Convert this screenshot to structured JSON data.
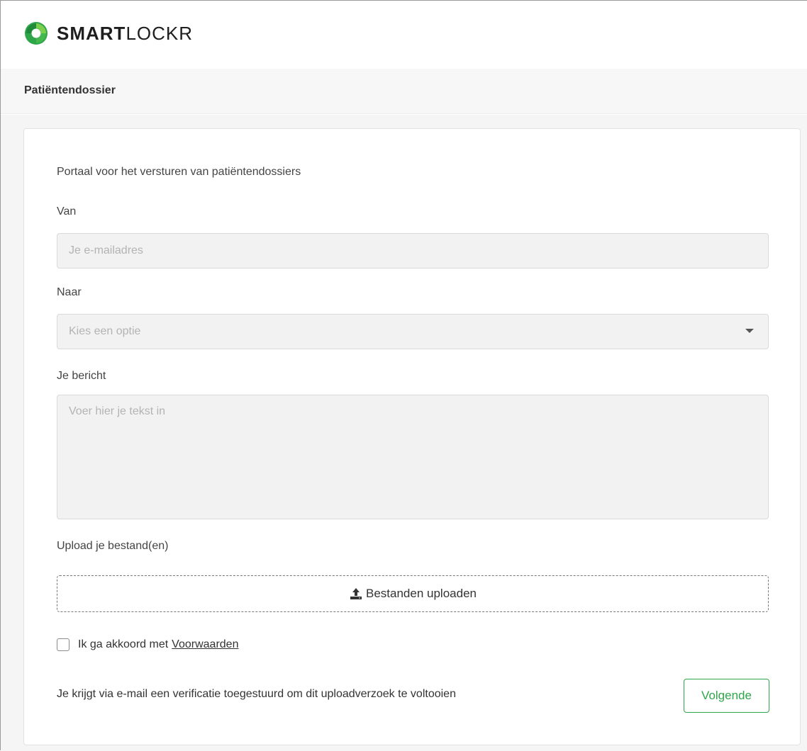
{
  "brand": {
    "name_bold": "SMART",
    "name_light": "LOCKR",
    "logo_icon": "smartlockr-logo-icon",
    "accent_color": "#2fa64a"
  },
  "section": {
    "title": "Patiëntendossier"
  },
  "form": {
    "intro": "Portaal voor het versturen van patiëntendossiers",
    "from": {
      "label": "Van",
      "placeholder": "Je e-mailadres",
      "value": ""
    },
    "to": {
      "label": "Naar",
      "placeholder": "Kies een optie",
      "icon": "chevron-down-icon"
    },
    "message": {
      "label": "Je bericht",
      "placeholder": "Voer hier je tekst in",
      "value": ""
    },
    "upload": {
      "label": "Upload je bestand(en)",
      "button_label": "Bestanden uploaden",
      "icon": "upload-icon"
    },
    "agree": {
      "checked": false,
      "text": "Ik ga akkoord met",
      "link_text": "Voorwaarden"
    },
    "footer_note": "Je krijgt via e-mail een verificatie toegestuurd om dit uploadverzoek te voltooien",
    "next_label": "Volgende"
  }
}
